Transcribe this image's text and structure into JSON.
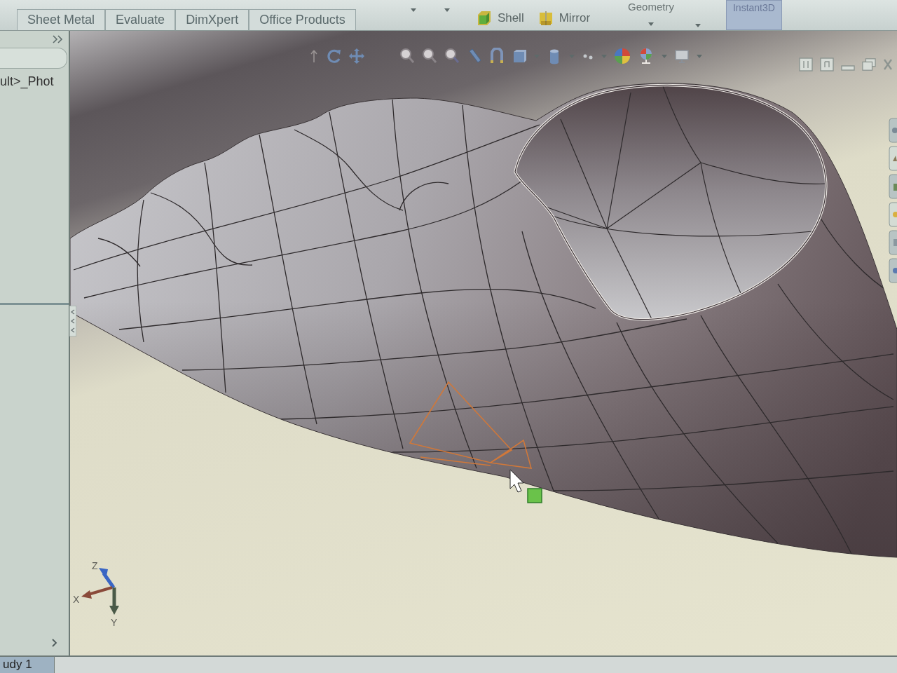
{
  "ribbon": {
    "tabs": [
      {
        "label": "Sheet Metal",
        "selected": false
      },
      {
        "label": "Evaluate",
        "selected": false
      },
      {
        "label": "DimXpert",
        "selected": false
      },
      {
        "label": "Office Products",
        "selected": false
      }
    ],
    "commands": [
      {
        "label": "Shell"
      },
      {
        "label": "Mirror"
      }
    ],
    "geometry": {
      "label": "Geometry"
    },
    "instant3d": {
      "label": "Instant3D",
      "on": true
    }
  },
  "feature_tree": {
    "items": [
      {
        "label": "ult>_Phot"
      }
    ]
  },
  "viewport": {
    "triad": {
      "z_label": "Z",
      "x_label": "X",
      "y_label": "Y"
    }
  },
  "bottom_tabs": [
    {
      "label": "udy 1",
      "selected": true
    }
  ]
}
